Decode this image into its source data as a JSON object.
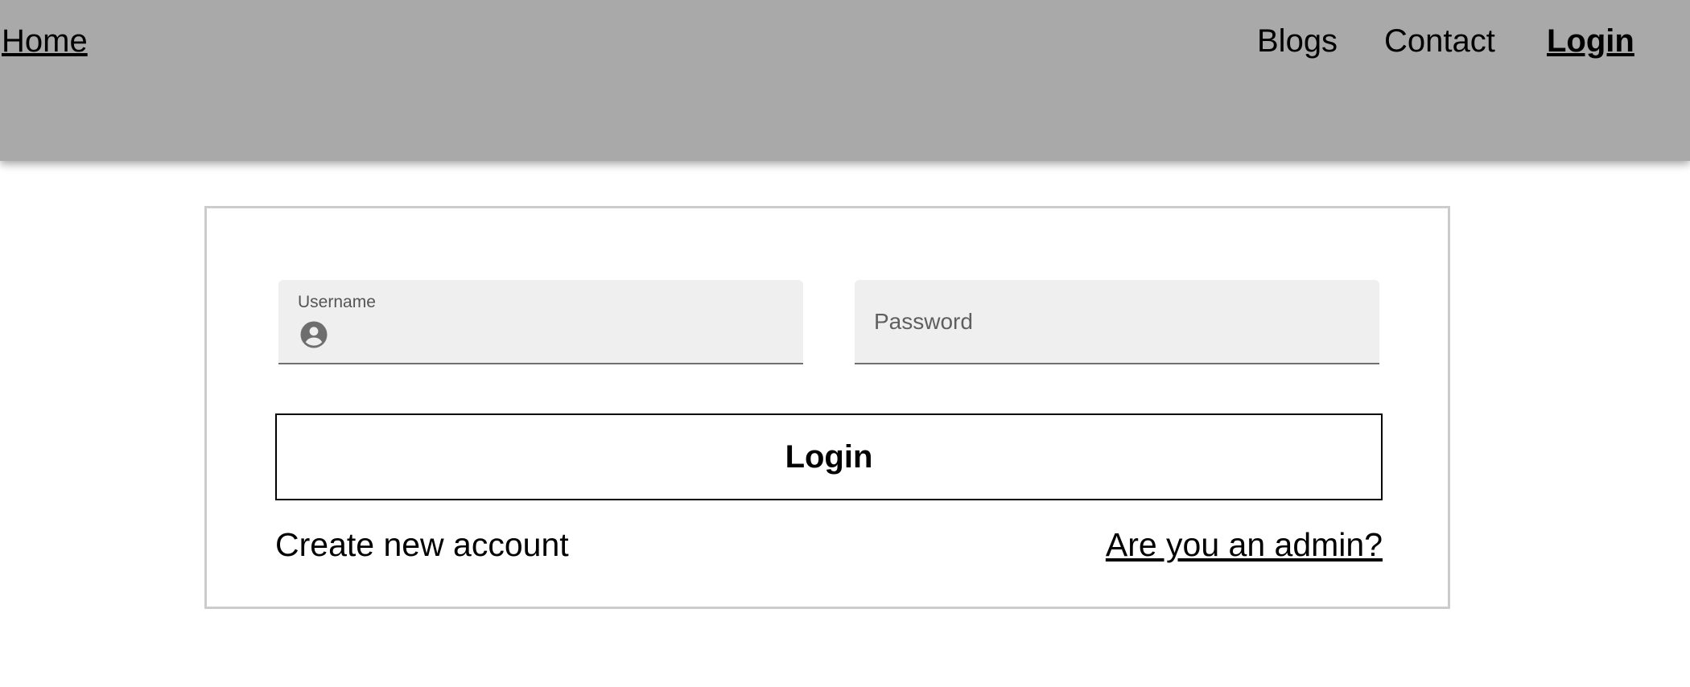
{
  "nav": {
    "home": "Home",
    "blogs": "Blogs",
    "contact": "Contact",
    "login": "Login"
  },
  "form": {
    "username": {
      "label": "Username",
      "value": "",
      "icon": "account-circle-icon"
    },
    "password": {
      "placeholder": "Password",
      "value": ""
    },
    "login_button": "Login",
    "create_account": "Create new account",
    "admin_link": "Are you an admin?"
  },
  "colors": {
    "header_bg": "#a9a9a9",
    "field_bg": "#efefef",
    "card_border": "#cccccc"
  }
}
